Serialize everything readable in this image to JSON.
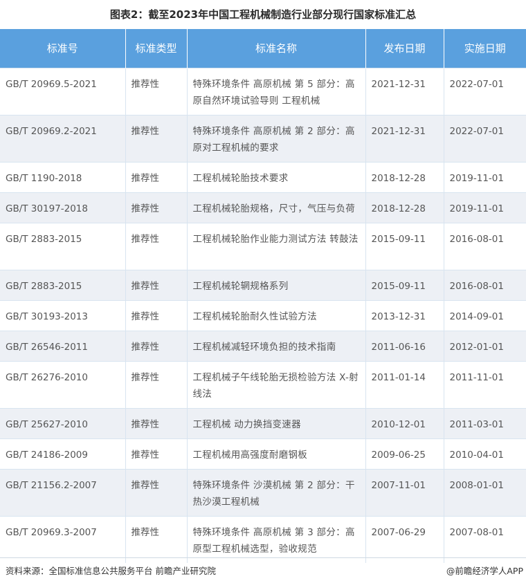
{
  "title": "图表2：截至2023年中国工程机械制造行业部分现行国家标准汇总",
  "table": {
    "headers": [
      "标准号",
      "标准类型",
      "标准名称",
      "发布日期",
      "实施日期"
    ],
    "rows": [
      {
        "id": "GB/T 20969.5-2021",
        "type": "推荐性",
        "name": "特殊环境条件 高原机械 第 5 部分：高原自然环境试验导则 工程机械",
        "publish": "2021-12-31",
        "effective": "2022-07-01"
      },
      {
        "id": "GB/T 20969.2-2021",
        "type": "推荐性",
        "name": "特殊环境条件 高原机械 第 2 部分：高原对工程机械的要求",
        "publish": "2021-12-31",
        "effective": "2022-07-01"
      },
      {
        "id": "GB/T 1190-2018",
        "type": "推荐性",
        "name": "工程机械轮胎技术要求",
        "publish": "2018-12-28",
        "effective": "2019-11-01"
      },
      {
        "id": "GB/T 30197-2018",
        "type": "推荐性",
        "name": "工程机械轮胎规格，尺寸，气压与负荷",
        "publish": "2018-12-28",
        "effective": "2019-11-01"
      },
      {
        "id": "GB/T 2883-2015",
        "type": "推荐性",
        "name": "工程机械轮胎作业能力测试方法 转鼓法",
        "publish": "2015-09-11",
        "effective": "2016-08-01"
      },
      {
        "id": "GB/T 2883-2015",
        "type": "推荐性",
        "name": "工程机械轮辋规格系列",
        "publish": "2015-09-11",
        "effective": "2016-08-01"
      },
      {
        "id": "GB/T 30193-2013",
        "type": "推荐性",
        "name": "工程机械轮胎耐久性试验方法",
        "publish": "2013-12-31",
        "effective": "2014-09-01"
      },
      {
        "id": "GB/T 26546-2011",
        "type": "推荐性",
        "name": "工程机械减轻环境负担的技术指南",
        "publish": "2011-06-16",
        "effective": "2012-01-01"
      },
      {
        "id": "GB/T 26276-2010",
        "type": "推荐性",
        "name": "工程机械子午线轮胎无损检验方法 X-射线法",
        "publish": "2011-01-14",
        "effective": "2011-11-01"
      },
      {
        "id": "GB/T 25627-2010",
        "type": "推荐性",
        "name": "工程机械 动力换挡变速器",
        "publish": "2010-12-01",
        "effective": "2011-03-01"
      },
      {
        "id": "GB/T 24186-2009",
        "type": "推荐性",
        "name": "工程机械用高强度耐磨钢板",
        "publish": "2009-06-25",
        "effective": "2010-04-01"
      },
      {
        "id": "GB/T 21156.2-2007",
        "type": "推荐性",
        "name": "特殊环境条件 沙漠机械 第 2 部分：干热沙漠工程机械",
        "publish": "2007-11-01",
        "effective": "2008-01-01"
      },
      {
        "id": "GB/T 20969.3-2007",
        "type": "推荐性",
        "name": "特殊环境条件 高原机械 第 3 部分：高原型工程机械选型，验收规范",
        "publish": "2007-06-29",
        "effective": "2007-08-01"
      }
    ]
  },
  "footer": {
    "source": "资料来源：全国标准信息公共服务平台 前瞻产业研究院",
    "brand": "@前瞻经济学人APP"
  },
  "colors": {
    "header_bg": "#5aa0de",
    "stripe_bg": "#edf0f5"
  }
}
